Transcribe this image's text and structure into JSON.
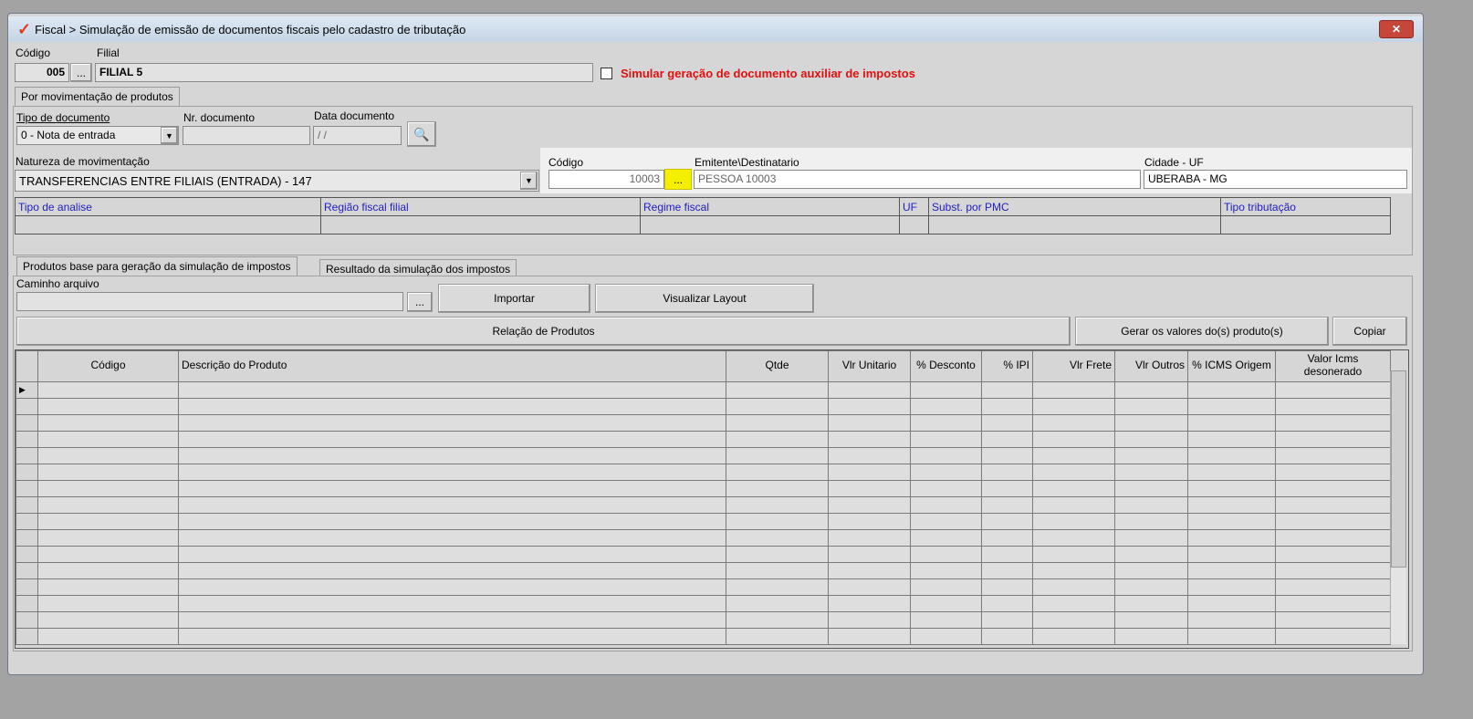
{
  "window": {
    "title": "Fiscal > Simulação de emissão de documentos fiscais pelo cadastro de tributação",
    "close": "✕"
  },
  "top": {
    "codigo_label": "Código",
    "codigo_value": "005",
    "filial_label": "Filial",
    "filial_value": "FILIAL 5",
    "lookup": "...",
    "simular_label": "Simular geração de documento auxiliar de impostos"
  },
  "tab_main": "Por movimentação de produtos",
  "form": {
    "tipo_doc_label": "Tipo de documento",
    "tipo_doc_value": "0 - Nota de entrada",
    "nr_doc_label": "Nr. documento",
    "nr_doc_value": "",
    "data_doc_label": "Data documento",
    "data_doc_value": " / /",
    "natureza_label": "Natureza de movimentação",
    "natureza_value": "TRANSFERENCIAS ENTRE FILIAIS (ENTRADA) - 147"
  },
  "emitente": {
    "codigo_label": "Código",
    "codigo_value": "10003",
    "lookup": "...",
    "emitente_label": "Emitente\\Destinatario",
    "emitente_value": "PESSOA 10003",
    "cidade_label": "Cidade - UF",
    "cidade_value": "UBERABA - MG"
  },
  "analysis_headers": [
    "Tipo de analise",
    "Região fiscal filial",
    "Regime fiscal",
    "UF",
    "Subst. por PMC",
    "Tipo tributação"
  ],
  "sub_tabs": [
    "Produtos base para geração da simulação de impostos",
    "Resultado da simulação dos impostos"
  ],
  "import": {
    "caminho_label": "Caminho arquivo",
    "caminho_value": "",
    "lookup": "...",
    "importar": "Importar",
    "visualizar": "Visualizar Layout"
  },
  "actions": {
    "relacao": "Relação de Produtos",
    "gerar": "Gerar os valores do(s) produto(s)",
    "copiar": "Copiar"
  },
  "grid": {
    "columns": [
      "",
      "Código",
      "Descrição do Produto",
      "Qtde",
      "Vlr Unitario",
      "% Desconto",
      "% IPI",
      "Vlr Frete",
      "Vlr Outros",
      "% ICMS Origem",
      "Valor Icms desonerado"
    ],
    "row_count": 16,
    "current_row_marker": "▶"
  },
  "colors": {
    "highlight": "#ffff00",
    "red_label": "#e01010",
    "header_blue": "#2020c0"
  }
}
